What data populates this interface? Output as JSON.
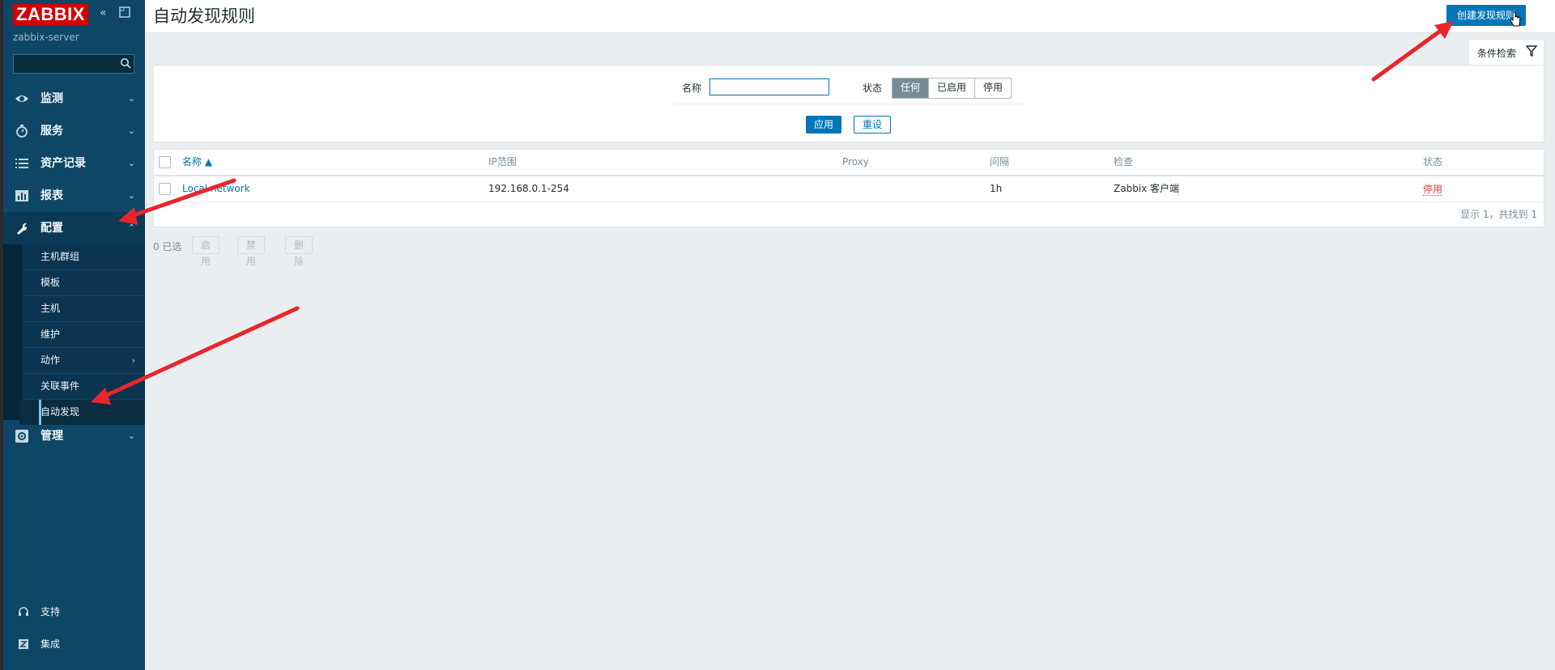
{
  "sidebar": {
    "logo": "ZABBIX",
    "server": "zabbix-server",
    "menu": [
      {
        "label": "监测"
      },
      {
        "label": "服务"
      },
      {
        "label": "资产记录"
      },
      {
        "label": "报表"
      },
      {
        "label": "配置"
      }
    ],
    "config_sub": [
      {
        "label": "主机群组"
      },
      {
        "label": "模板"
      },
      {
        "label": "主机"
      },
      {
        "label": "维护"
      },
      {
        "label": "动作"
      },
      {
        "label": "关联事件"
      },
      {
        "label": "自动发现"
      }
    ],
    "admin": "管理",
    "support": "支持",
    "integrations": "集成"
  },
  "header": {
    "title": "自动发现规则",
    "create_button": "创建发现规则"
  },
  "filter": {
    "tab_label": "条件检索",
    "name_label": "名称",
    "name_value": "",
    "status_label": "状态",
    "status_options": [
      "任何",
      "已启用",
      "停用"
    ],
    "status_selected": "任何",
    "apply": "应用",
    "reset": "重设"
  },
  "table": {
    "columns": [
      "名称 ▲",
      "IP范围",
      "Proxy",
      "间隔",
      "检查",
      "状态"
    ],
    "rows": [
      {
        "name": "Local network",
        "ip_range": "192.168.0.1-254",
        "proxy": "",
        "interval": "1h",
        "checks": "Zabbix 客户端",
        "status": "停用"
      }
    ],
    "footer": "显示 1，共找到 1"
  },
  "mass_actions": {
    "selected": "0 已选",
    "enable": "启用",
    "disable": "禁用",
    "delete": "删除"
  },
  "colors": {
    "sidebar": "#0e4766",
    "accent": "#0275b8",
    "logo_red": "#d40000",
    "disabled_red": "#e33734",
    "annotation_arrow": "#e8262d"
  }
}
